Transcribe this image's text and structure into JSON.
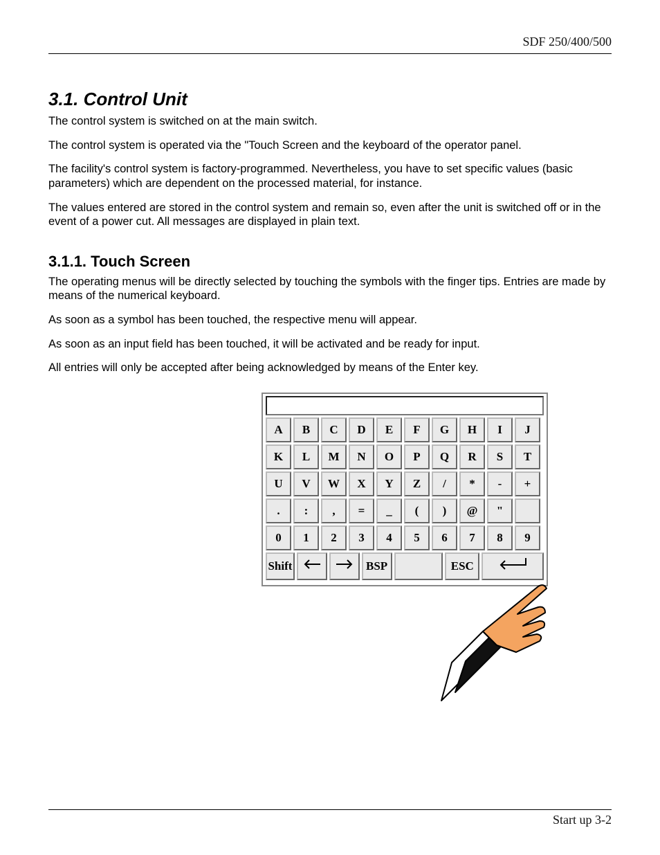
{
  "header": {
    "right": "SDF 250/400/500"
  },
  "footer": {
    "right": "Start up 3-2"
  },
  "section": {
    "number_title": "3.1.  Control Unit",
    "paragraphs": [
      "The control system is switched on at the main switch.",
      "The control system is operated via  the \"Touch Screen and the keyboard of the operator panel.",
      "The facility's control system is factory-programmed. Nevertheless, you have to set specific values (basic parameters) which are dependent on the processed material, for instance.",
      "The values entered are stored in the control system and remain so, even after the unit is switched off or in the event of a power cut. All messages are displayed in plain text."
    ]
  },
  "subsection": {
    "number_title": "3.1.1. Touch Screen",
    "paragraphs": [
      "The operating menus will be directly selected by touching the symbols with the finger tips. Entries are made by means of the numerical keyboard.",
      "As soon as a symbol has been touched, the respective menu will appear.",
      "As soon as an input field has been touched, it will be activated and be ready for input.",
      "All entries will only be accepted after being acknowledged by means of the Enter key."
    ]
  },
  "keyboard": {
    "row1": [
      "A",
      "B",
      "C",
      "D",
      "E",
      "F",
      "G",
      "H",
      "I",
      "J"
    ],
    "row2": [
      "K",
      "L",
      "M",
      "N",
      "O",
      "P",
      "Q",
      "R",
      "S",
      "T"
    ],
    "row3": [
      "U",
      "V",
      "W",
      "X",
      "Y",
      "Z",
      "/",
      "*",
      "-",
      "+"
    ],
    "row4": [
      ".",
      ":",
      ",",
      "=",
      "_",
      "(",
      ")",
      "@",
      "\"",
      ""
    ],
    "row5": [
      "0",
      "1",
      "2",
      "3",
      "4",
      "5",
      "6",
      "7",
      "8",
      "9"
    ],
    "row6": {
      "shift": "Shift",
      "arrow_left": "←",
      "arrow_right": "→",
      "bsp": "BSP",
      "blank": "",
      "esc": "ESC",
      "enter": "↵"
    }
  }
}
